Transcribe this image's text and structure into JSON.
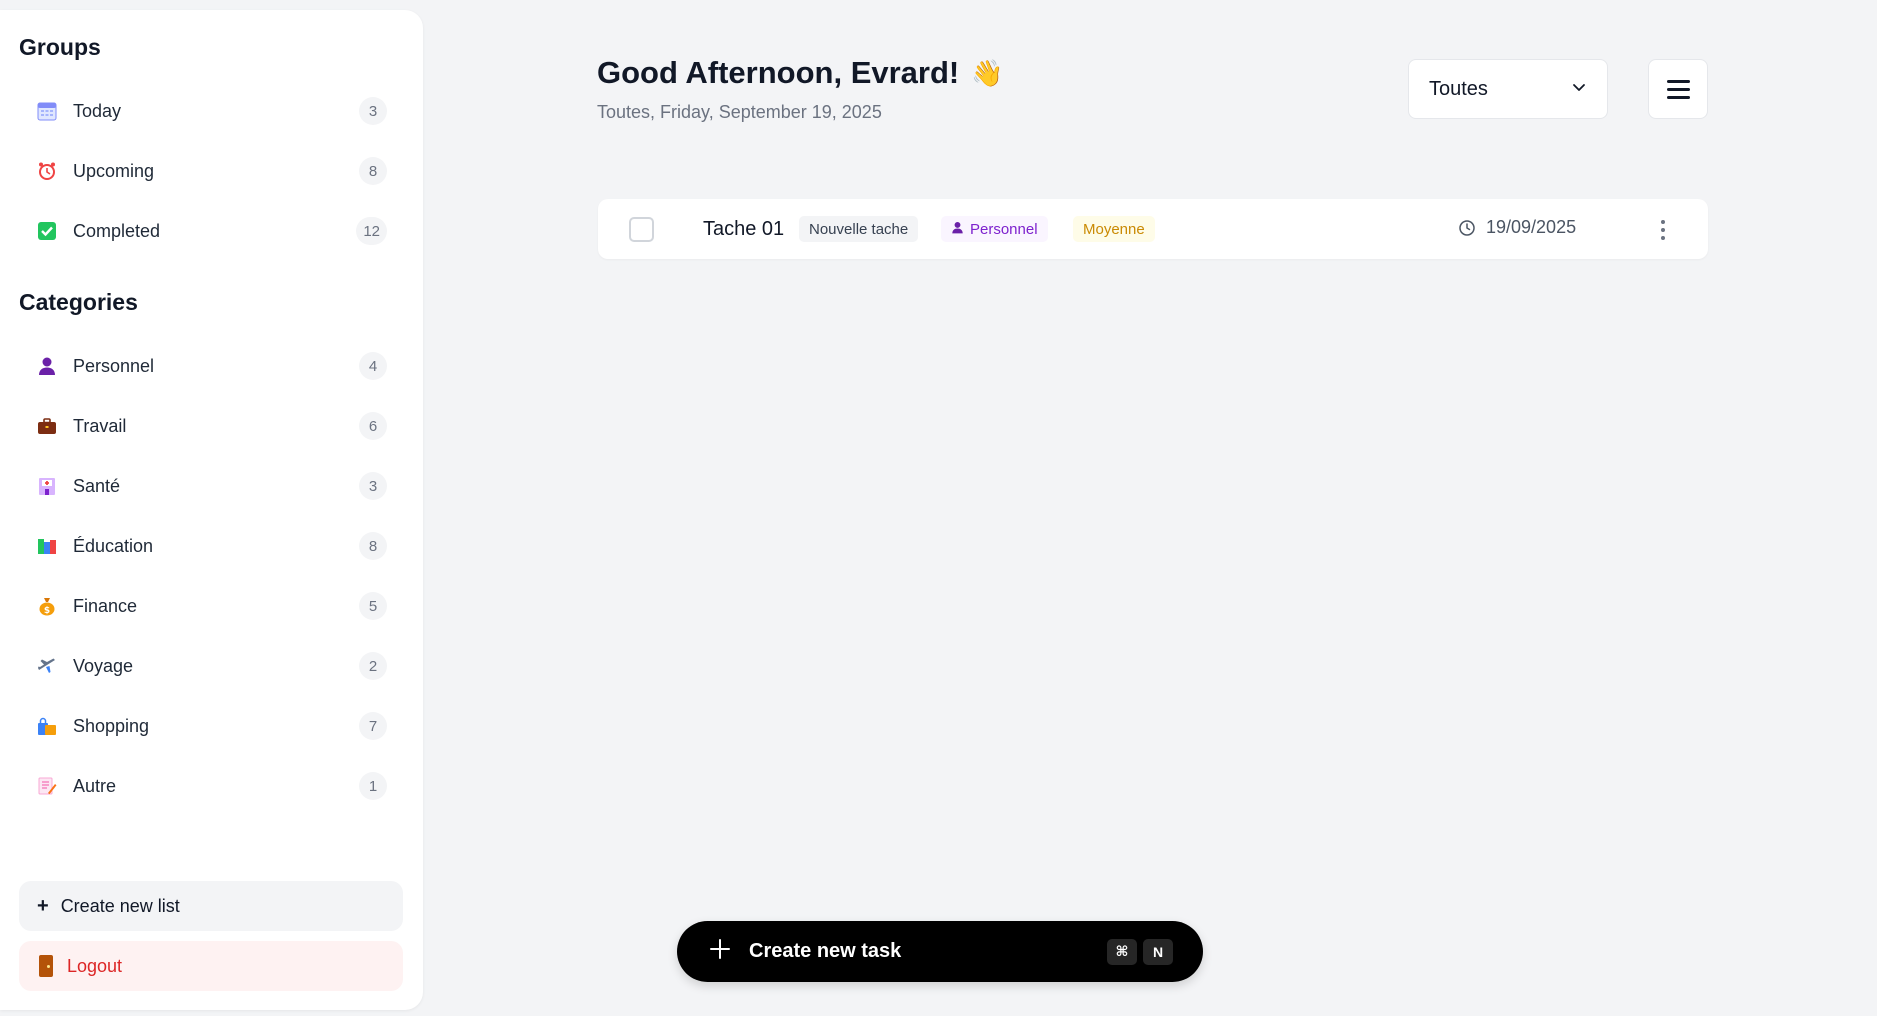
{
  "sidebar": {
    "groups_title": "Groups",
    "groups": [
      {
        "label": "Today",
        "count": "3",
        "icon": "calendar-icon"
      },
      {
        "label": "Upcoming",
        "count": "8",
        "icon": "alarm-clock-icon"
      },
      {
        "label": "Completed",
        "count": "12",
        "icon": "check-box-icon"
      }
    ],
    "categories_title": "Categories",
    "categories": [
      {
        "label": "Personnel",
        "count": "4",
        "icon": "person-icon"
      },
      {
        "label": "Travail",
        "count": "6",
        "icon": "briefcase-icon"
      },
      {
        "label": "Santé",
        "count": "3",
        "icon": "hospital-icon"
      },
      {
        "label": "Éducation",
        "count": "8",
        "icon": "books-icon"
      },
      {
        "label": "Finance",
        "count": "5",
        "icon": "money-bag-icon"
      },
      {
        "label": "Voyage",
        "count": "2",
        "icon": "airplane-icon"
      },
      {
        "label": "Shopping",
        "count": "7",
        "icon": "shopping-bags-icon"
      },
      {
        "label": "Autre",
        "count": "1",
        "icon": "memo-icon"
      }
    ],
    "create_list_label": "Create new list",
    "logout_label": "Logout"
  },
  "header": {
    "greeting": "Good Afternoon, Evrard!",
    "wave_emoji": "👋",
    "subtitle": "Toutes, Friday, September 19, 2025",
    "filter_value": "Toutes"
  },
  "tasks": [
    {
      "title": "Tache 01",
      "description": "Nouvelle tache",
      "category": "Personnel",
      "priority": "Moyenne",
      "date": "19/09/2025"
    }
  ],
  "create_task": {
    "label": "Create new task",
    "shortcut_key1": "⌘",
    "shortcut_key2": "N"
  },
  "colors": {
    "background": "#f3f4f6",
    "category_tag": "#7e22ce",
    "priority_tag": "#ca8a04",
    "logout": "#dc2626"
  }
}
